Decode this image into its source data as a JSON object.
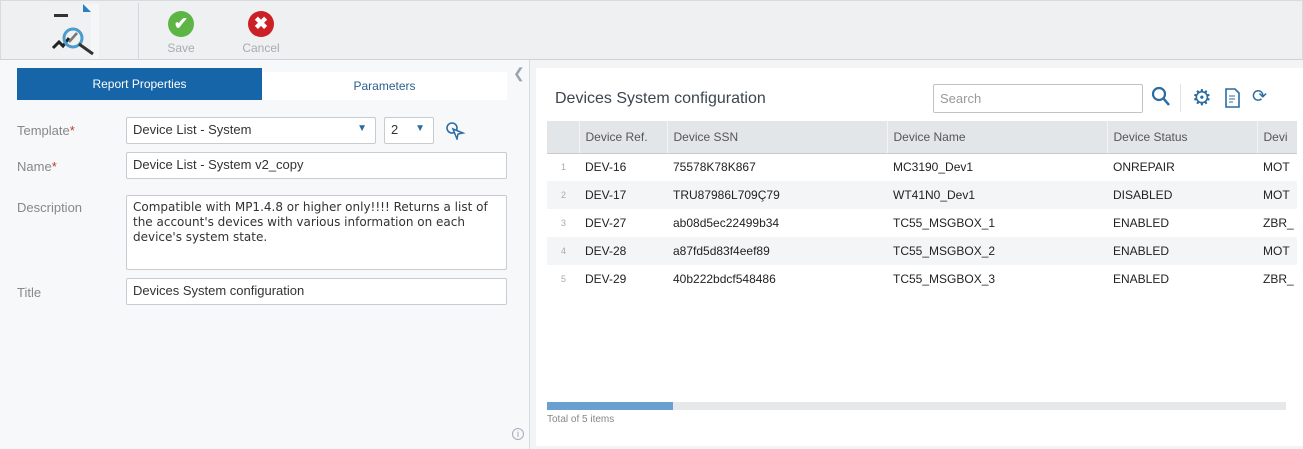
{
  "toolbar": {
    "save": "Save",
    "cancel": "Cancel"
  },
  "tabs": {
    "report_properties": "Report Properties",
    "parameters": "Parameters"
  },
  "form": {
    "template_label": "Template",
    "template_value": "Device List - System",
    "version_value": "2",
    "name_label": "Name",
    "name_value": "Device List - System v2_copy",
    "description_label": "Description",
    "description_value": "Compatible with MP1.4.8 or higher only!!!! Returns a list of the account's devices with various information on each device's system state.",
    "title_label": "Title",
    "title_value": "Devices System configuration",
    "required_mark": "*"
  },
  "report": {
    "title": "Devices System configuration",
    "search_placeholder": "Search",
    "columns": [
      "Device Ref.",
      "Device SSN",
      "Device Name",
      "Device Status",
      "Devi"
    ],
    "rows": [
      [
        "1",
        "DEV-16",
        "75578K78K867",
        "MC3190_Dev1",
        "ONREPAIR",
        "MOT"
      ],
      [
        "2",
        "DEV-17",
        "TRU87986L709Ç79",
        "WT41N0_Dev1",
        "DISABLED",
        "MOT"
      ],
      [
        "3",
        "DEV-27",
        "ab08d5ec22499b34",
        "TC55_MSGBOX_1",
        "ENABLED",
        "ZBR_"
      ],
      [
        "4",
        "DEV-28",
        "a87fd5d83f4eef89",
        "TC55_MSGBOX_2",
        "ENABLED",
        "MOT"
      ],
      [
        "5",
        "DEV-29",
        "40b222bdcf548486",
        "TC55_MSGBOX_3",
        "ENABLED",
        "ZBR_"
      ]
    ],
    "total": "Total of 5 items",
    "scroll_fraction": 0.17
  }
}
